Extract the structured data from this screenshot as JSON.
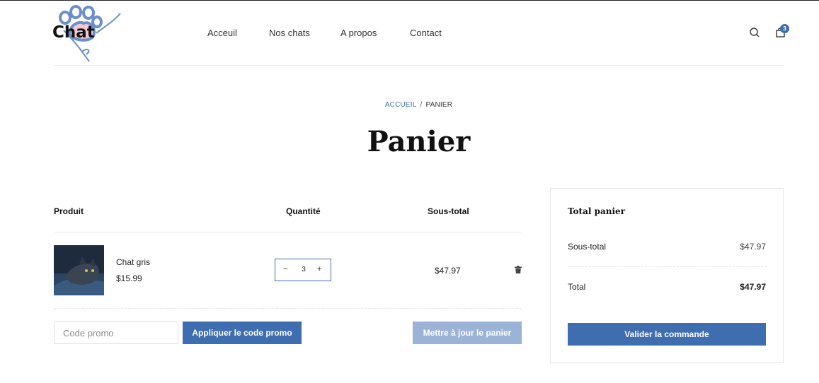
{
  "brand": {
    "name": "Chat"
  },
  "nav": {
    "items": [
      "Acceuil",
      "Nos chats",
      "A propos",
      "Contact"
    ]
  },
  "header": {
    "cart_count": "3"
  },
  "breadcrumb": {
    "home": "ACCUEIL",
    "separator": "/",
    "current": "PANIER"
  },
  "page": {
    "title": "Panier"
  },
  "cart": {
    "headers": {
      "product": "Produit",
      "quantity": "Quantité",
      "subtotal": "Sous-total"
    },
    "items": [
      {
        "name": "Chat gris",
        "price": "$15.99",
        "quantity": "3",
        "subtotal": "$47.97"
      }
    ],
    "promo": {
      "placeholder": "Code promo",
      "apply_label": "Appliquer le code promo"
    },
    "update_label": "Mettre à jour le panier"
  },
  "totals": {
    "title": "Total panier",
    "subtotal_label": "Sous-total",
    "subtotal_value": "$47.97",
    "total_label": "Total",
    "total_value": "$47.97",
    "checkout_label": "Valider la commande"
  },
  "icons": {
    "search": "search-icon",
    "cart": "shopping-bag-icon",
    "delete": "trash-icon",
    "minus": "minus-icon",
    "plus": "plus-icon"
  },
  "colors": {
    "accent": "#3f6eb0",
    "accent_light": "#9bb3d6"
  }
}
